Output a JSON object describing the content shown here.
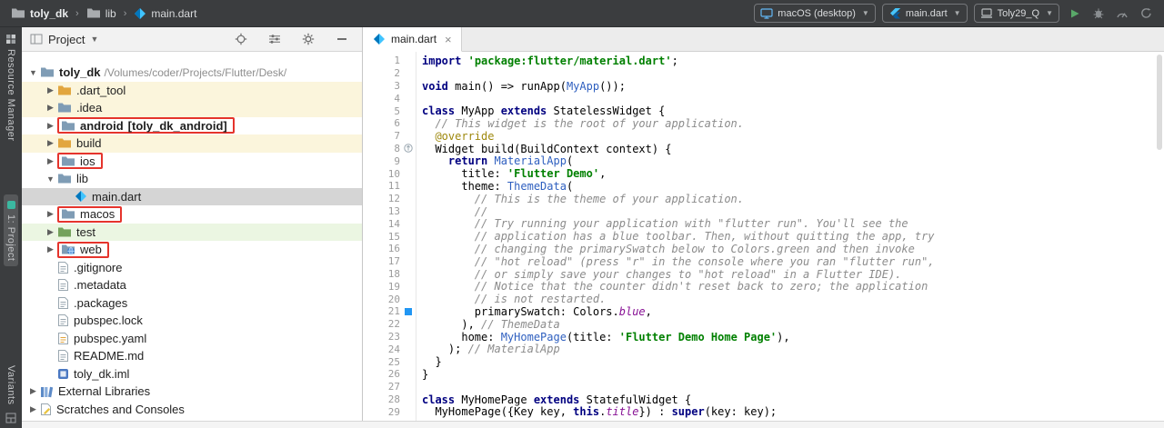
{
  "colors": {
    "chrome": "#3B3D3F",
    "red": "#E5342C",
    "row-sel": "#D5D5D5",
    "row-yellow": "#FBF5DC",
    "row-green": "#EBF6E2",
    "swatch": "#2196F3",
    "c-kw": "#000080",
    "c-str": "#008000",
    "c-com": "#8C8C8C",
    "c-cls": "#2E5FBF",
    "c-ann": "#9E880D",
    "c-mem": "#871094"
  },
  "titlebar": {
    "breadcrumbs": [
      {
        "label": "toly_dk",
        "icon": "folder-dark"
      },
      {
        "label": "lib",
        "icon": "folder-dark"
      },
      {
        "label": "main.dart",
        "icon": "dart"
      }
    ],
    "device_selector": {
      "label": "macOS (desktop)",
      "icon": "monitor"
    },
    "run_config": {
      "label": "main.dart",
      "icon": "flutter"
    },
    "device2": {
      "label": "Toly29_Q",
      "icon": "laptop"
    },
    "actions": [
      {
        "name": "run",
        "icon": "play"
      },
      {
        "name": "attach-debugger",
        "icon": "bug"
      },
      {
        "name": "profiler",
        "icon": "gauge"
      },
      {
        "name": "hot-restart",
        "icon": "refresh"
      }
    ]
  },
  "left_strip": {
    "resource_manager": "Resource Manager",
    "project_tab": "1: Project",
    "variants": "Variants"
  },
  "project_panel": {
    "title": "Project",
    "actions": [
      {
        "name": "locate-file",
        "icon": "crosshair"
      },
      {
        "name": "view-options",
        "icon": "sliders"
      },
      {
        "name": "settings",
        "icon": "gear"
      },
      {
        "name": "hide-panel",
        "icon": "minus"
      }
    ],
    "tree": [
      {
        "indent": 0,
        "chevron": "down",
        "icon": "folder",
        "label": "toly_dk",
        "bold": true,
        "path": "/Volumes/coder/Projects/Flutter/Desk/"
      },
      {
        "indent": 1,
        "chevron": "right",
        "icon": "folder-excluded",
        "label": ".dart_tool",
        "row_bg": "yellow"
      },
      {
        "indent": 1,
        "chevron": "right",
        "icon": "folder",
        "label": ".idea",
        "row_bg": "yellow"
      },
      {
        "indent": 1,
        "chevron": "right",
        "icon": "folder",
        "label": "android",
        "bold": true,
        "suffix": " [toly_dk_android]",
        "redbox": true
      },
      {
        "indent": 1,
        "chevron": "right",
        "icon": "folder-excluded",
        "label": "build",
        "row_bg": "yellow"
      },
      {
        "indent": 1,
        "chevron": "right",
        "icon": "folder",
        "label": "ios",
        "redbox": true
      },
      {
        "indent": 1,
        "chevron": "down",
        "icon": "folder",
        "label": "lib"
      },
      {
        "indent": 2,
        "chevron": null,
        "icon": "dart",
        "label": "main.dart",
        "selected": true
      },
      {
        "indent": 1,
        "chevron": "right",
        "icon": "folder",
        "label": "macos",
        "redbox": true
      },
      {
        "indent": 1,
        "chevron": "right",
        "icon": "folder-test",
        "label": "test",
        "row_bg": "green"
      },
      {
        "indent": 1,
        "chevron": "right",
        "icon": "folder-web",
        "label": "web",
        "redbox": true
      },
      {
        "indent": 1,
        "chevron": null,
        "icon": "page",
        "label": ".gitignore"
      },
      {
        "indent": 1,
        "chevron": null,
        "icon": "page",
        "label": ".metadata"
      },
      {
        "indent": 1,
        "chevron": null,
        "icon": "page",
        "label": ".packages"
      },
      {
        "indent": 1,
        "chevron": null,
        "icon": "page",
        "label": "pubspec.lock"
      },
      {
        "indent": 1,
        "chevron": null,
        "icon": "yaml",
        "label": "pubspec.yaml"
      },
      {
        "indent": 1,
        "chevron": null,
        "icon": "page",
        "label": "README.md"
      },
      {
        "indent": 1,
        "chevron": null,
        "icon": "iml",
        "label": "toly_dk.iml"
      },
      {
        "indent": 0,
        "chevron": "right",
        "icon": "libs",
        "label": "External Libraries"
      },
      {
        "indent": 0,
        "chevron": "right",
        "icon": "scratch",
        "label": "Scratches and Consoles"
      }
    ]
  },
  "editor": {
    "tab": "main.dart",
    "gutter_markers": {
      "8": "override",
      "21": "color"
    },
    "color_swatch": "#2196F3",
    "lines": [
      [
        [
          "kw",
          "import"
        ],
        [
          "pl",
          " "
        ],
        [
          "str",
          "'package:flutter/material.dart'"
        ],
        [
          "pl",
          ";"
        ]
      ],
      [],
      [
        [
          "kw",
          "void"
        ],
        [
          "pl",
          " main() => runApp("
        ],
        [
          "cls",
          "MyApp"
        ],
        [
          "pl",
          "());"
        ]
      ],
      [],
      [
        [
          "kw",
          "class"
        ],
        [
          "pl",
          " MyApp "
        ],
        [
          "kw",
          "extends"
        ],
        [
          "pl",
          " StatelessWidget {"
        ]
      ],
      [
        [
          "com",
          "  // This widget is the root of your application."
        ]
      ],
      [
        [
          "pl",
          "  "
        ],
        [
          "ann",
          "@override"
        ]
      ],
      [
        [
          "pl",
          "  Widget build(BuildContext context) {"
        ]
      ],
      [
        [
          "pl",
          "    "
        ],
        [
          "kw",
          "return"
        ],
        [
          "pl",
          " "
        ],
        [
          "cls",
          "MaterialApp"
        ],
        [
          "pl",
          "("
        ]
      ],
      [
        [
          "pl",
          "      title: "
        ],
        [
          "str",
          "'Flutter Demo'"
        ],
        [
          "pl",
          ","
        ]
      ],
      [
        [
          "pl",
          "      theme: "
        ],
        [
          "cls",
          "ThemeData"
        ],
        [
          "pl",
          "("
        ]
      ],
      [
        [
          "com",
          "        // This is the theme of your application."
        ]
      ],
      [
        [
          "com",
          "        //"
        ]
      ],
      [
        [
          "com",
          "        // Try running your application with \"flutter run\". You'll see the"
        ]
      ],
      [
        [
          "com",
          "        // application has a blue toolbar. Then, without quitting the app, try"
        ]
      ],
      [
        [
          "com",
          "        // changing the primarySwatch below to Colors.green and then invoke"
        ]
      ],
      [
        [
          "com",
          "        // \"hot reload\" (press \"r\" in the console where you ran \"flutter run\","
        ]
      ],
      [
        [
          "com",
          "        // or simply save your changes to \"hot reload\" in a Flutter IDE)."
        ]
      ],
      [
        [
          "com",
          "        // Notice that the counter didn't reset back to zero; the application"
        ]
      ],
      [
        [
          "com",
          "        // is not restarted."
        ]
      ],
      [
        [
          "pl",
          "        primarySwatch: Colors."
        ],
        [
          "mem",
          "blue"
        ],
        [
          "pl",
          ","
        ]
      ],
      [
        [
          "pl",
          "      ), "
        ],
        [
          "com",
          "// ThemeData"
        ]
      ],
      [
        [
          "pl",
          "      home: "
        ],
        [
          "cls",
          "MyHomePage"
        ],
        [
          "pl",
          "(title: "
        ],
        [
          "str",
          "'Flutter Demo Home Page'"
        ],
        [
          "pl",
          "),"
        ]
      ],
      [
        [
          "pl",
          "    ); "
        ],
        [
          "com",
          "// MaterialApp"
        ]
      ],
      [
        [
          "pl",
          "  }"
        ]
      ],
      [
        [
          "pl",
          "}"
        ]
      ],
      [],
      [
        [
          "kw",
          "class"
        ],
        [
          "pl",
          " MyHomePage "
        ],
        [
          "kw",
          "extends"
        ],
        [
          "pl",
          " StatefulWidget {"
        ]
      ],
      [
        [
          "pl",
          "  MyHomePage({Key key, "
        ],
        [
          "kw",
          "this"
        ],
        [
          "pl",
          "."
        ],
        [
          "mem",
          "title"
        ],
        [
          "pl",
          "}) : "
        ],
        [
          "kw",
          "super"
        ],
        [
          "pl",
          "(key: key);"
        ]
      ]
    ]
  }
}
